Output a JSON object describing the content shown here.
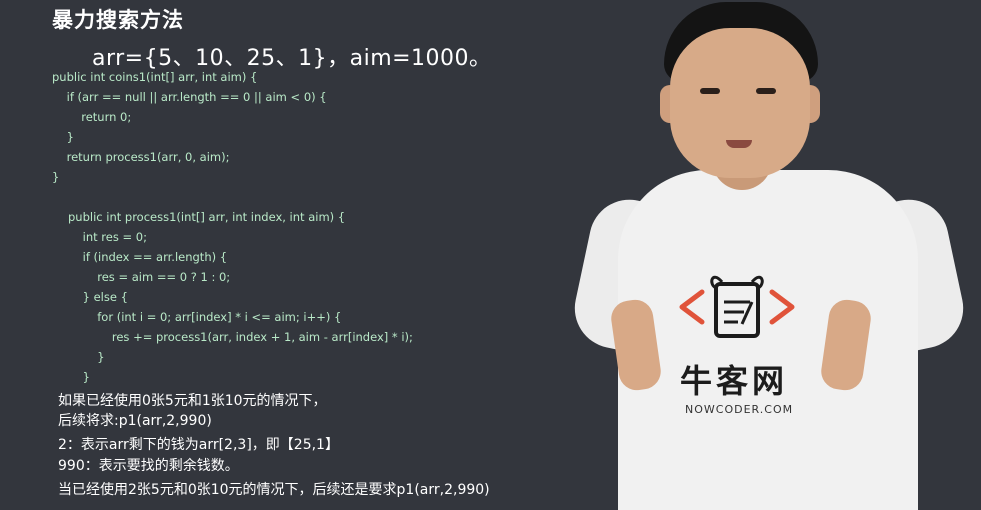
{
  "slide": {
    "title": "暴力搜索方法",
    "subtitle": "arr={5、10、25、1}，aim=1000。",
    "code_lines": [
      "public int coins1(int[] arr, int aim) {",
      "    if (arr == null || arr.length == 0 || aim < 0) {",
      "        return 0;",
      "    }",
      "    return process1(arr, 0, aim);",
      "}",
      "",
      "public int process1(int[] arr, int index, int aim) {",
      "    int res = 0;",
      "    if (index == arr.length) {",
      "        res = aim == 0 ? 1 : 0;",
      "    } else {",
      "        for (int i = 0; arr[index] * i <= aim; i++) {",
      "            res += process1(arr, index + 1, aim - arr[index] * i);",
      "        }",
      "    }"
    ],
    "notes": [
      "如果已经使用0张5元和1张10元的情况下，",
      "后续将求:p1(arr,2,990)",
      "2：表示arr剩下的钱为arr[2,3]，即【25,1】",
      "990：表示要找的剩余钱数。",
      "当已经使用2张5元和0张10元的情况下，后续还是要求p1(arr,2,990)"
    ]
  },
  "presenter": {
    "shirt_logo_text": "牛客网",
    "shirt_logo_sub": "NOWCODER.COM",
    "logo_color": "#e0533a"
  }
}
